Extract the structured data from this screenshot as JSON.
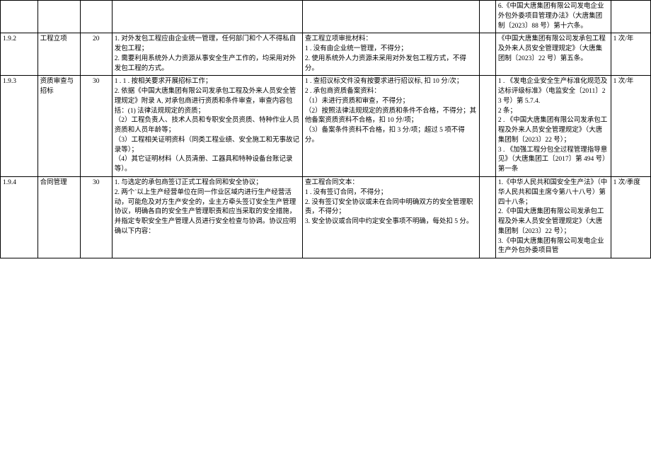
{
  "rows": [
    {
      "id": "",
      "name": "",
      "score": "",
      "c4": "",
      "c5": "",
      "c6": "",
      "c7": "6.《中国大唐集团有限公司发电企业外包外委项目管理办法》（大唐集团制〔2023〕88 号）第十六条。",
      "c8": ""
    },
    {
      "id": "1.9.2",
      "name": "工程立项",
      "score": "20",
      "c4": "1. 对外发包工程应由企业统一管理，任何部门和个人不得私自发包工程；\n2. 需要利用系统外人力资源从事安全生产工作的，均采用对外发包工程的方式。",
      "c5": "查工程立项审批材料：\n1    . 没有由企业统一管理，不得分；\n2. 使用系统外人力资源未采用对外发包工程方式，不得分。",
      "c6": "",
      "c7": "《中国大唐集团有限公司发承包工程及外来人员安全管理规定》（大唐集团制〔2023〕22 号）第五条。",
      "c8": "1 次/年"
    },
    {
      "id": "1.9.3",
      "name": "资质审查与招标",
      "score": "30",
      "c4": "1         . 1           . 按相关要求开展招标工作；\n2. 依据《中国大唐集团有限公司发承包工程及外来人员安全管理规定》附录 A, 对承包商进行资质和条件审查，审查内容包括：(1) 法律法规规定的资质；\n（2）工程负责人、技术人员和专职安全员资质、特种作业人员资质和人员年龄等；\n  （3）工程相关证明资料（同类工程业绩、安全施工和无事故记录等）；\n （4）其它证明材料（人员清册、工器具和特种设备台账记录等）。",
      "c5": "1        . 查招议标文件没有按要求进行招议标, 扣 10 分/次；\n2       . 承包商资质备案资料：\n （1）未进行资质和审查，不得分；\n （2）按照法律法规规定的资质和条件不合格，不得分；其他备案资质资料不合格，扣 10 分/项；\n （3）备案条件资料不合格，扣 3 分/项；超过 5 项不得分。",
      "c6": "",
      "c7": "1        . 《发电企业安全生产标准化规范及达标评级标准》（电监安全〔2011〕23 号）第 5.7.4.\n2 条；\n2          . 《中国大唐集团有限公司发承包工程及外来人员安全管理规定》（大唐集团制〔2023〕22 号）；\n3            . 《加强工程分包全过程管理指导意见》（大唐集团工〔2017〕第 494 号）第一条",
      "c8": "1 次/年"
    },
    {
      "id": "1.9.4",
      "name": "合同管理",
      "score": "30",
      "c4": "1. 与选定的承包商签订正式工程合同和安全协议；\n2. 两个`以上生产经营单位在同一作业区域内进行生产经营活动，可能危及对方生产安全的，业主方牵头签订安全生产管理协议，明确各自的安全生产管理职责和应当采取的安全措施，并指定专职安全生产管理人员进行安全检查与协调。协议应明确以下内容：",
      "c5": "查工程合同文本：\n1          . 没有签订合同，不得分；\n2. 没有签订安全协议或未在合同中明确双方的安全管理职责，不得分；\n3. 安全协议或合同中约定安全事项不明确，每处扣 5 分。",
      "c6": "",
      "c7": "1.《中华人民共和国安全生产法》（中华人民共和国主席令第八十八号）第四十八条；\n2.《中国大唐集团有限公司发承包工程及外来人员安全管理规定》（大唐集团制〔2023〕22 号）；\n3.《中国大唐集团有限公司发电企业生产外包外委项目管",
      "c8": "1 次/季度"
    }
  ]
}
